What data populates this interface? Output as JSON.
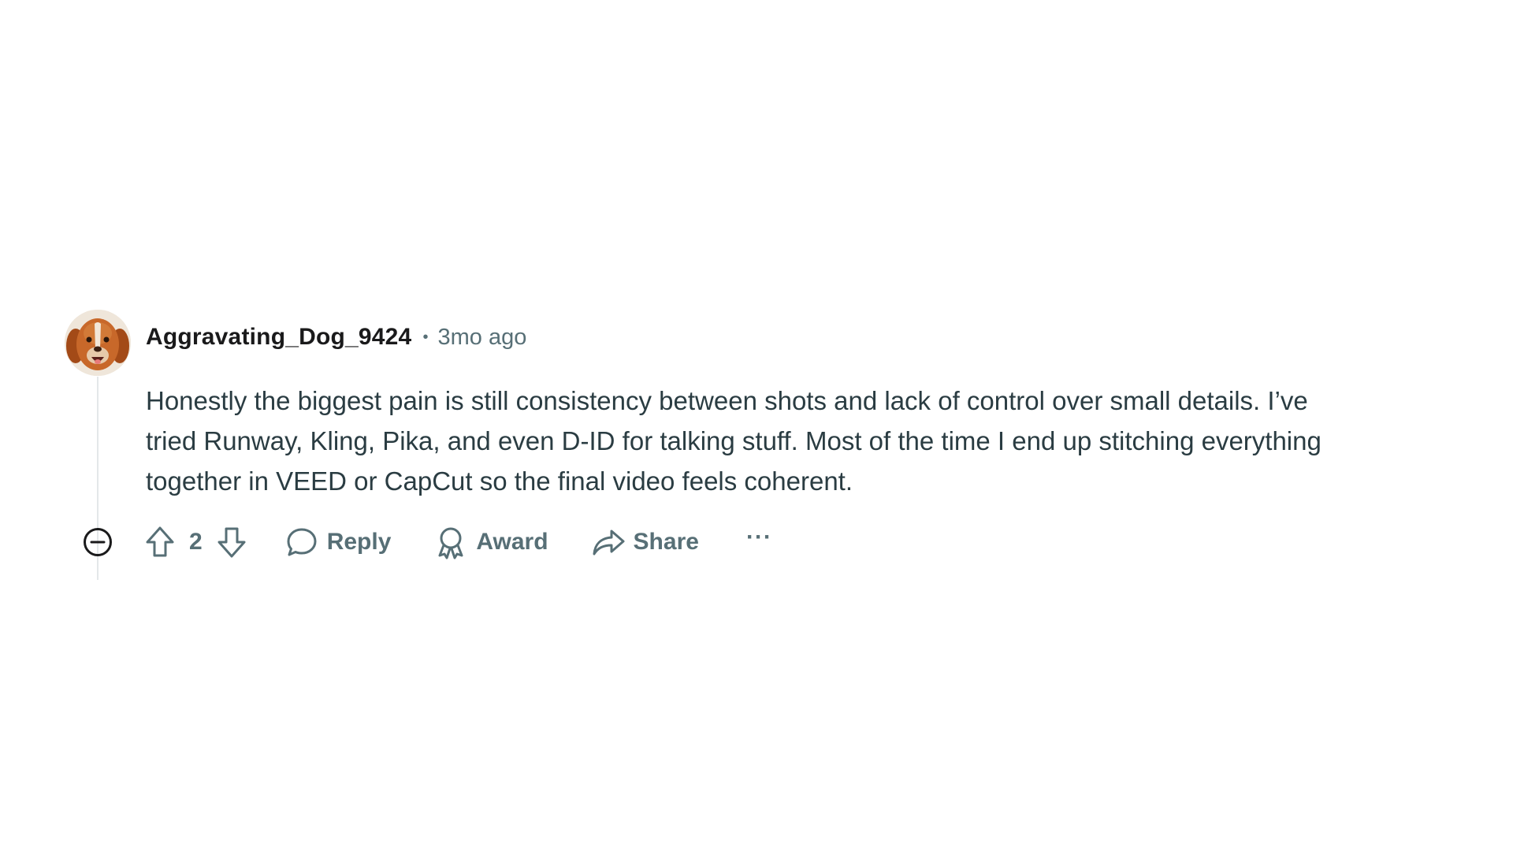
{
  "comment": {
    "username": "Aggravating_Dog_9424",
    "separator": "•",
    "timestamp": "3mo ago",
    "body_lines": [
      "Honestly the biggest pain is still consistency between shots and lack of control over small details. I’ve",
      "tried Runway, Kling, Pika, and even D-ID for talking stuff. Most of the time I end up stitching everything",
      "together in VEED or CapCut so the final video feels coherent."
    ],
    "avatar_icon": "dog-avatar",
    "score": "2",
    "actions": {
      "reply_label": "Reply",
      "award_label": "Award",
      "share_label": "Share",
      "more_label": "···"
    }
  },
  "icons": {
    "collapse": "collapse-minus-icon",
    "upvote": "upvote-arrow-icon",
    "downvote": "downvote-arrow-icon",
    "reply": "speech-bubble-icon",
    "award": "award-ribbon-icon",
    "share": "share-arrow-icon"
  },
  "colors": {
    "meta_gray": "#576f76",
    "body_text": "#2a3c42",
    "thread_line": "#e4e7e9"
  }
}
